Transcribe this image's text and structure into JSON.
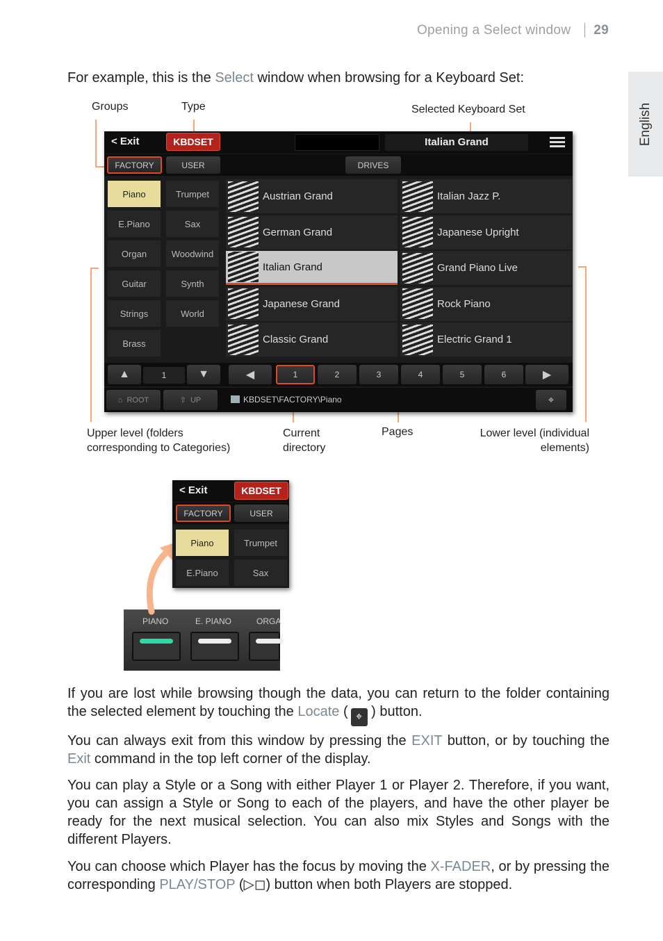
{
  "header": {
    "section": "Opening a Select window",
    "page": "29"
  },
  "language_tab": "English",
  "intro": {
    "before": "For example, this is the ",
    "highlight": "Select",
    "after": " window when browsing for a Keyboard Set:"
  },
  "callouts": {
    "groups": "Groups",
    "type": "Type",
    "selected": "Selected Keyboard Set",
    "upper": "Upper level (folders corresponding to Categories)",
    "current": "Current directory",
    "pages": "Pages",
    "lower": "Lower level (individual elements)"
  },
  "screen": {
    "exit": "< Exit",
    "type": "KBDSET",
    "selected_name": "Italian Grand",
    "tabs": [
      "FACTORY",
      "USER",
      "DRIVES"
    ],
    "groups": [
      "Piano",
      "Trumpet",
      "E.Piano",
      "Sax",
      "Organ",
      "Woodwind",
      "Guitar",
      "Synth",
      "Strings",
      "World",
      "Brass"
    ],
    "selected_group": "Piano",
    "items": [
      "Austrian Grand",
      "Italian Jazz P.",
      "German Grand",
      "Japanese Upright",
      "Italian Grand",
      "Grand Piano Live",
      "Japanese Grand",
      "Rock Piano",
      "Classic Grand",
      "Electric Grand 1"
    ],
    "selected_item": "Italian Grand",
    "group_page": "1",
    "pages": [
      "1",
      "2",
      "3",
      "4",
      "5",
      "6"
    ],
    "current_page": "1",
    "root": "ROOT",
    "up": "UP",
    "path": "KBDSET\\FACTORY\\Piano",
    "accent": "#e04a1e",
    "selected_group_color": "#e8dc9c"
  },
  "inset": {
    "exit": "< Exit",
    "type": "KBDSET",
    "tabs": [
      "FACTORY",
      "USER"
    ],
    "groups": [
      "Piano",
      "Trumpet",
      "E.Piano",
      "Sax"
    ],
    "panel_buttons": [
      "PIANO",
      "E. PIANO",
      "ORGA"
    ],
    "led_active": "#2ed9a8"
  },
  "paragraphs": [
    {
      "parts": [
        "If you are lost while browsing though the data, you can return to the folder containing the selected element by touching the ",
        "Locate",
        " (",
        " ) button."
      ]
    },
    {
      "parts": [
        "You can always exit from this window by pressing the ",
        "EXIT",
        " button, or by touching the ",
        "Exit",
        " command in the top left corner of the display."
      ]
    },
    {
      "parts": [
        "You can play a Style or a Song with either Player 1 or Player 2. Therefore, if you want, you can assign a Style or Song to each of the players, and have the other player be ready for the next musical selection. You can also mix Styles and Songs with the different Players."
      ]
    },
    {
      "parts": [
        "You can choose which Player has the focus by moving the ",
        "X-FADER",
        ", or by pressing the corresponding ",
        "PLAY/STOP",
        " (",
        "▷◻",
        ") button when both Players are stopped."
      ]
    }
  ]
}
